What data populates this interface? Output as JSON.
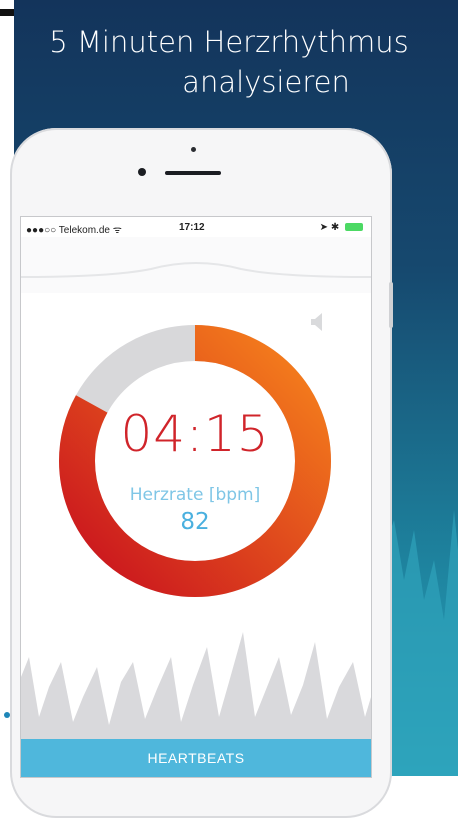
{
  "headline": {
    "line1": "5 Minuten Herzrhythmus",
    "line2": "analysieren"
  },
  "statusbar": {
    "carrier": "●●●○○ Telekom.de ᯤ",
    "time": "17:12",
    "right": "➤ ✱"
  },
  "timer": {
    "value": "04:15",
    "progress": 0.83
  },
  "heart_rate": {
    "label": "Herzrate [bpm]",
    "value": "82"
  },
  "bottom_tab": {
    "label": "HEARTBEATS"
  },
  "colors": {
    "ring_start": "#c8101e",
    "ring_end": "#f7841c",
    "ring_track": "#d8d8da",
    "accent": "#4fb7dc"
  },
  "icons": {
    "sound": "speaker-icon",
    "wifi": "wifi-icon",
    "location": "location-icon",
    "bluetooth": "bluetooth-icon",
    "battery": "battery-icon"
  }
}
